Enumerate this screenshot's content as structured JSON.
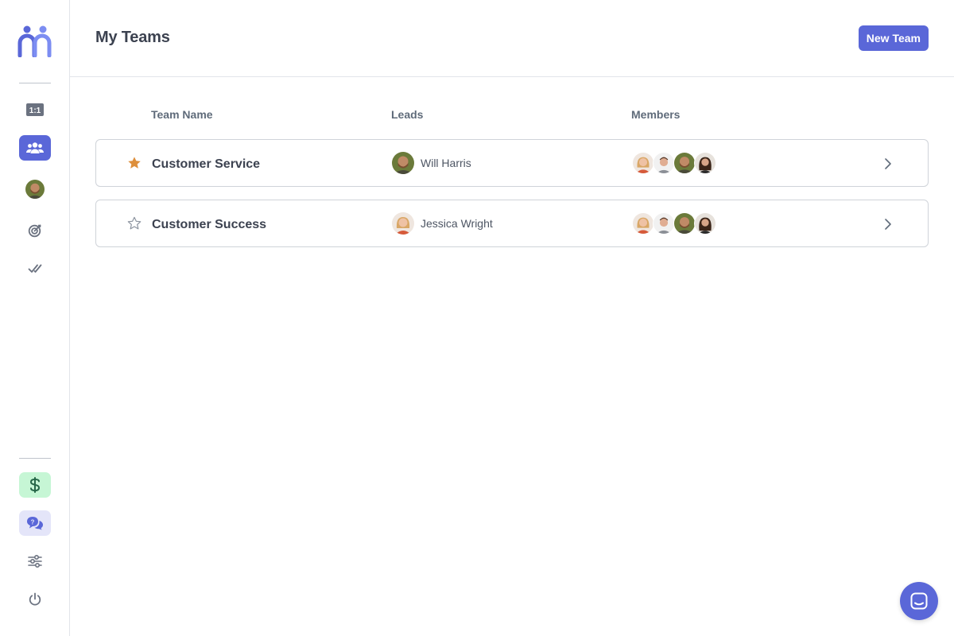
{
  "header": {
    "title": "My Teams",
    "new_team_label": "New Team"
  },
  "sidebar": {
    "logo_icon": "logo-icon",
    "top_items": [
      {
        "name": "one-on-one",
        "icon": "one-on-one-icon",
        "label": "1:1",
        "active": false
      },
      {
        "name": "teams",
        "icon": "users-icon",
        "active": true
      },
      {
        "name": "profile",
        "icon": "avatar",
        "active": false
      },
      {
        "name": "goals",
        "icon": "target-icon",
        "active": false
      },
      {
        "name": "tasks",
        "icon": "double-check-icon",
        "active": false
      }
    ],
    "bottom_items": [
      {
        "name": "billing",
        "icon": "dollar-icon"
      },
      {
        "name": "feedback",
        "icon": "chat-bubbles-icon"
      },
      {
        "name": "settings",
        "icon": "sliders-icon"
      },
      {
        "name": "logout",
        "icon": "power-icon"
      }
    ]
  },
  "table": {
    "columns": {
      "team_name": "Team Name",
      "leads": "Leads",
      "members": "Members"
    },
    "rows": [
      {
        "team_name": "Customer Service",
        "favorite": true,
        "lead": "Will Harris"
      },
      {
        "team_name": "Customer Success",
        "favorite": false,
        "lead": "Jessica Wright"
      }
    ]
  },
  "colors": {
    "accent": "#5a67d8",
    "star_filled": "#dd8f3c",
    "border": "#cfd3d9",
    "billing_bg": "#c6f6d5",
    "feedback_bg": "#e4e5f9"
  },
  "chat": {
    "icon": "chat-icon"
  }
}
